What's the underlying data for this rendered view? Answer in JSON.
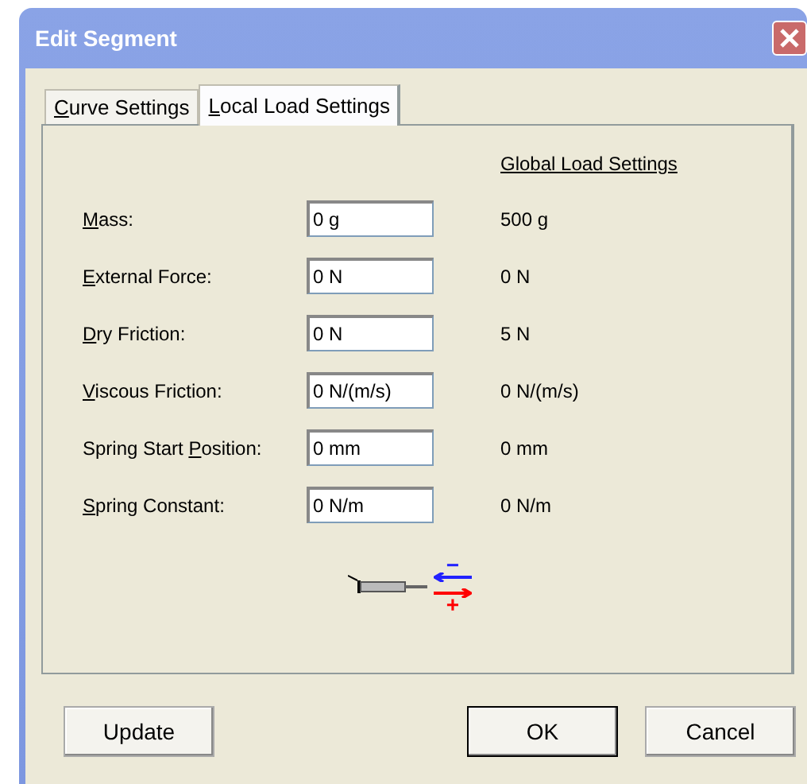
{
  "window": {
    "title": "Edit Segment"
  },
  "tabs": [
    {
      "label": {
        "key": "C",
        "after": "urve Settings"
      },
      "selected": false
    },
    {
      "label": {
        "key": "L",
        "after": "ocal Load Settings"
      },
      "selected": true
    }
  ],
  "global_heading": "Global Load Settings",
  "rows": [
    {
      "label": {
        "key": "M",
        "after": "ass:"
      },
      "value": "0 g",
      "global": "500 g"
    },
    {
      "label": {
        "key": "E",
        "after": "xternal Force:"
      },
      "value": "0 N",
      "global": "0 N"
    },
    {
      "label": {
        "key": "D",
        "after": "ry Friction:"
      },
      "value": "0 N",
      "global": "5 N"
    },
    {
      "label": {
        "key": "V",
        "after": "iscous Friction:"
      },
      "value": "0 N/(m/s)",
      "global": "0 N/(m/s)"
    },
    {
      "label": {
        "before": "Spring Start ",
        "key": "P",
        "after": "osition:"
      },
      "value": "0 mm",
      "global": "0 mm"
    },
    {
      "label": {
        "key": "S",
        "after": "pring Constant:"
      },
      "value": "0 N/m",
      "global": "0 N/m"
    }
  ],
  "direction_marks": {
    "minus": "−",
    "plus": "+"
  },
  "buttons": [
    {
      "label": "Update",
      "default": false
    },
    {
      "label": "OK",
      "default": true
    },
    {
      "label": "Cancel",
      "default": false
    }
  ]
}
